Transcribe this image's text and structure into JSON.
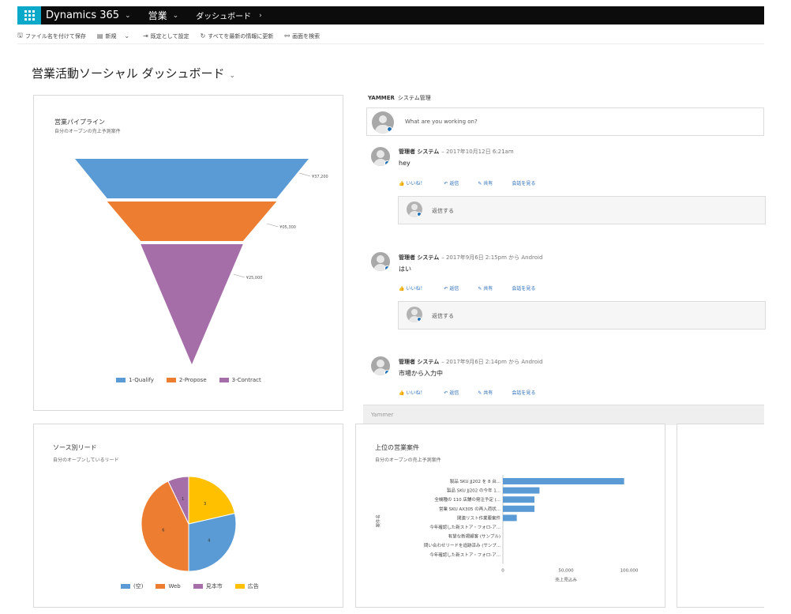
{
  "nav": {
    "brand": "Dynamics 365",
    "area": "営業",
    "crumb": "ダッシュボード"
  },
  "commands": [
    {
      "icon": "save-icon",
      "label": "ファイル名を付けて保存"
    },
    {
      "icon": "new-icon",
      "label": "新規"
    },
    {
      "icon": "set-default-icon",
      "label": "既定として設定"
    },
    {
      "icon": "refresh-icon",
      "label": "すべてを最新の情報に更新"
    },
    {
      "icon": "binoculars-icon",
      "label": "画面を検索"
    }
  ],
  "dashboard": {
    "title": "営業活動ソーシャル ダッシュボード"
  },
  "funnel": {
    "title": "営業パイプライン",
    "subtitle": "自分のオープンの売上予測案件",
    "colors": [
      "#5b9bd5",
      "#ed7d31",
      "#a66ea8"
    ]
  },
  "yammer": {
    "header_brand": "YAMMER",
    "header_label": "システム管理",
    "compose_placeholder": "What are you working on?",
    "reply_placeholder": "返信する",
    "footer": "Yammer",
    "actions": [
      "いいね！",
      "返信",
      "共有",
      "会話を見る"
    ],
    "posts": [
      {
        "author": "管理者 システム",
        "meta": "– 2017年10月12日 6:21am",
        "body": "hey"
      },
      {
        "author": "管理者 システム",
        "meta": "– 2017年9月6日 2:15pm から Android",
        "body": "はい"
      },
      {
        "author": "管理者 システム",
        "meta": "– 2017年9月6日 2:14pm から Android",
        "body": "市場から入力中"
      }
    ]
  },
  "pie": {
    "title": "ソース別リード",
    "subtitle": "自分のオープンしているリード"
  },
  "bar": {
    "title": "上位の営業案件",
    "subtitle": "自分のオープンの売上予測案件"
  },
  "chart_data": [
    {
      "type": "funnel",
      "categories": [
        "1-Qualify",
        "2-Propose",
        "3-Contract"
      ],
      "values": [
        437200,
        405300,
        325000
      ],
      "labels": [
        "¥37,200",
        "¥05,300",
        "¥25,000"
      ]
    },
    {
      "type": "pie",
      "categories": [
        "(空)",
        "Web",
        "見本市",
        "広告"
      ],
      "values": [
        4,
        6,
        1,
        3
      ],
      "colors": [
        "#5b9bd5",
        "#ed7d31",
        "#a66ea8",
        "#ffc000"
      ]
    },
    {
      "type": "bar",
      "orientation": "horizontal",
      "categories": [
        "製品 SKU JJ202 を 8 台...",
        "製品 SKU JJ202 の今年 1...",
        "全機種の 110 店舗の発注予定 (...",
        "営業 SKU AX305 の再入荷状...",
        "関連リスト作業要案件",
        "今年確認した新ストア・フォロ-ア...",
        "有望な新規顧客 (サンプル)",
        "問い合わせリードを追跡済み (サンプ...",
        "今年確認した新ストア・フォロ-ア..."
      ],
      "values": [
        96000,
        29000,
        25000,
        25000,
        11000,
        0,
        0,
        0,
        0
      ],
      "xlim": [
        0,
        100000
      ],
      "xticks": [
        "0",
        "50,000",
        "100,000"
      ],
      "xlabel": "売上見込み",
      "ylabel": "案件名",
      "color": "#5b9bd5"
    }
  ]
}
